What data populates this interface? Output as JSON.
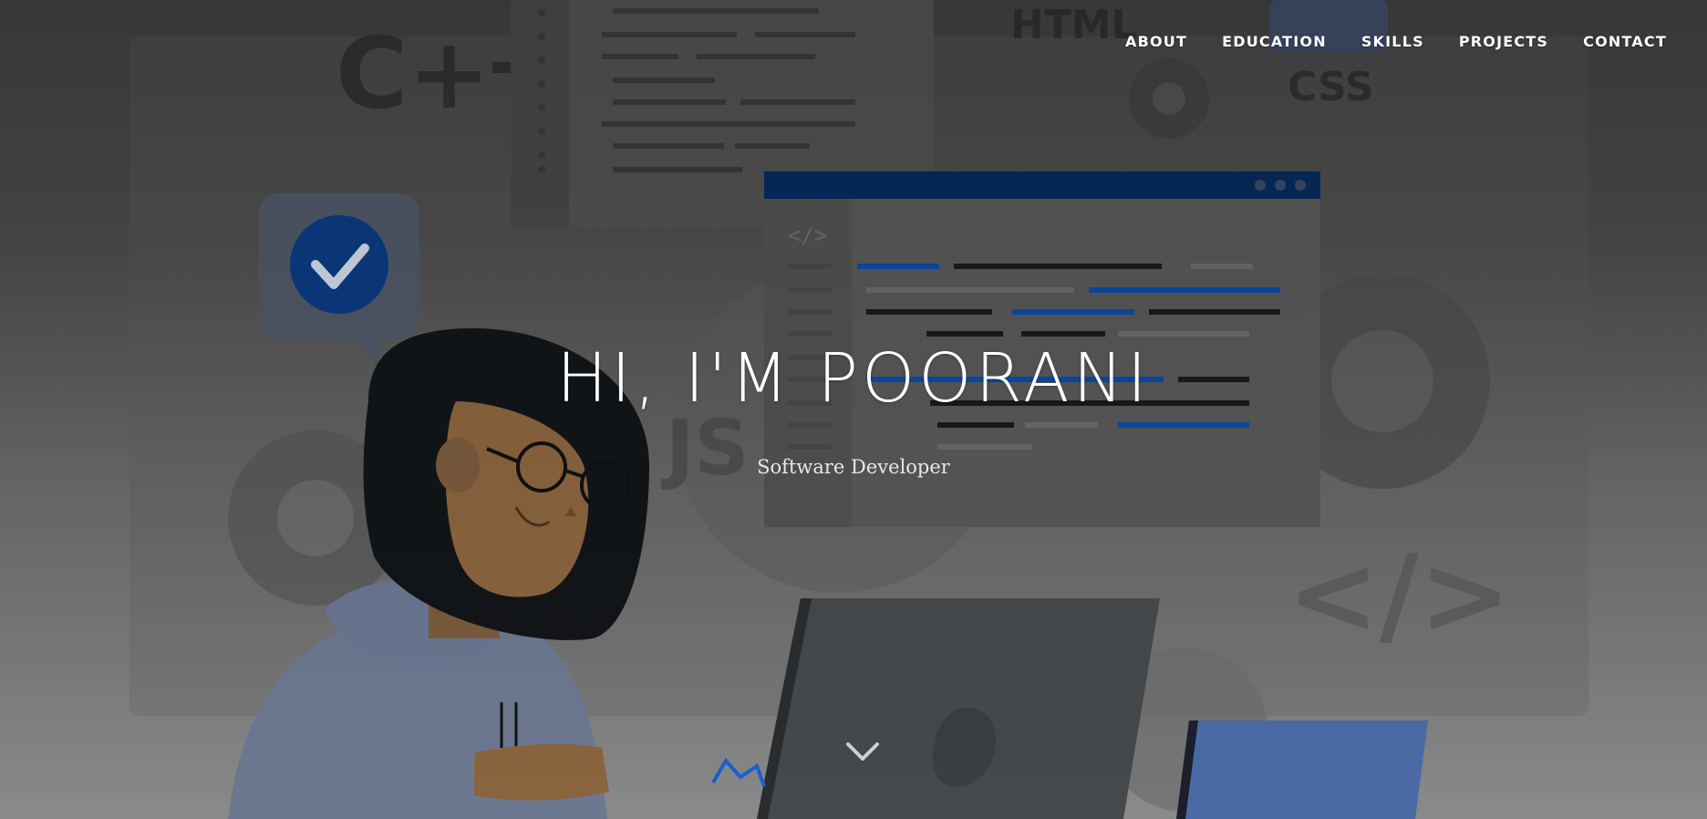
{
  "nav": {
    "items": [
      {
        "label": "ABOUT"
      },
      {
        "label": "EDUCATION"
      },
      {
        "label": "SKILLS"
      },
      {
        "label": "PROJECTS"
      },
      {
        "label": "CONTACT"
      }
    ]
  },
  "hero": {
    "title": "HI, I'M POORANI",
    "subtitle": "Software Developer"
  },
  "illustration": {
    "badges": {
      "cpp": "C+",
      "html": "HTML",
      "css": "CSS",
      "js": "JS",
      "code_tag": "</>",
      "small_code_tag": "</>"
    }
  },
  "icons": {
    "scroll": "chevron-down-icon",
    "check": "check-icon",
    "gear": "gear-icon"
  },
  "colors": {
    "accent_blue": "#0b4aa8",
    "window_bar": "#062a5c",
    "nav_text": "#ffffff"
  }
}
